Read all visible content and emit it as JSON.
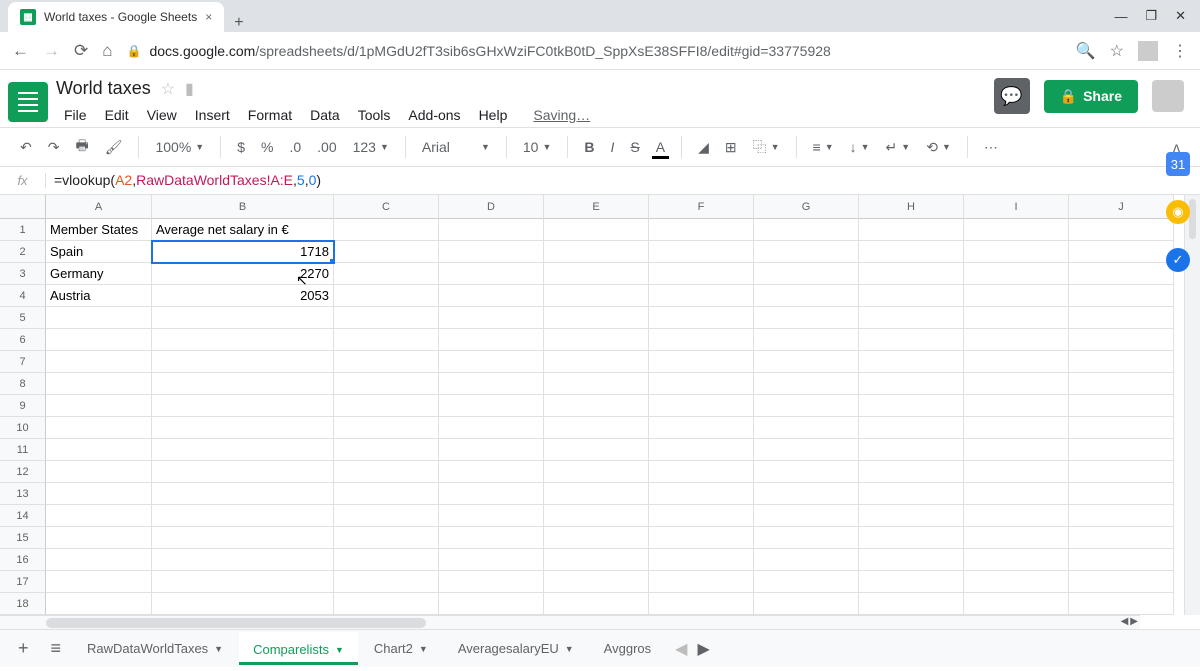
{
  "browser": {
    "tab_title": "World taxes - Google Sheets",
    "url_domain": "docs.google.com",
    "url_path": "/spreadsheets/d/1pMGdU2fT3sib6sGHxWziFC0tkB0tD_SppXsE38SFFI8/edit#gid=33775928"
  },
  "doc": {
    "title": "World taxes",
    "saving": "Saving…"
  },
  "menus": [
    "File",
    "Edit",
    "View",
    "Insert",
    "Format",
    "Data",
    "Tools",
    "Add-ons",
    "Help"
  ],
  "share_label": "Share",
  "toolbar": {
    "zoom": "100%",
    "num_format": "123",
    "font": "Arial",
    "font_size": "10"
  },
  "formula": {
    "prefix": "=vlookup(",
    "ref1": "A2",
    "comma1": ",",
    "ref2": "RawDataWorldTaxes!A:E",
    "comma2": ",",
    "num1": "5",
    "comma3": ",",
    "num2": "0",
    "suffix": ")"
  },
  "columns": [
    "A",
    "B",
    "C",
    "D",
    "E",
    "F",
    "G",
    "H",
    "I",
    "J"
  ],
  "rows": [
    "1",
    "2",
    "3",
    "4",
    "5",
    "6",
    "7",
    "8",
    "9",
    "10",
    "11",
    "12",
    "13",
    "14",
    "15",
    "16",
    "17",
    "18"
  ],
  "data": {
    "A1": "Member States",
    "B1": "Average net salary in €",
    "A2": "Spain",
    "B2": "1718",
    "A3": "Germany",
    "B3": "2270",
    "A4": "Austria",
    "B4": "2053"
  },
  "sheet_tabs": [
    "RawDataWorldTaxes",
    "Comparelists",
    "Chart2",
    "AveragesalaryEU",
    "Avggros"
  ],
  "active_sheet_index": 1
}
